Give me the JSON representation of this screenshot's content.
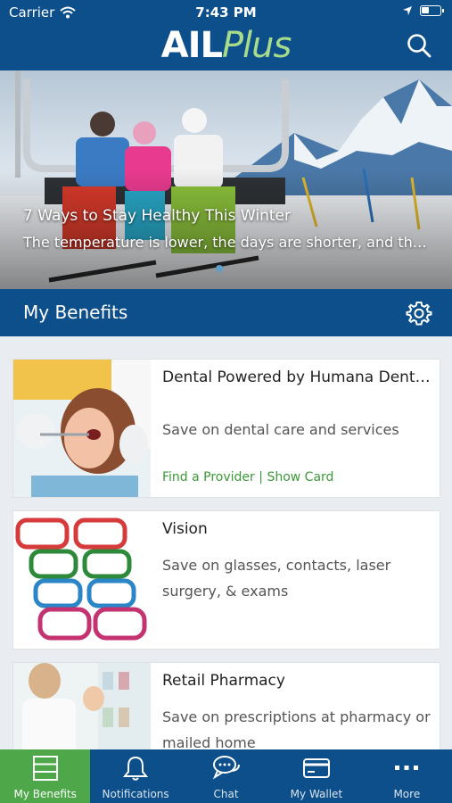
{
  "status_bar": {
    "carrier": "Carrier",
    "time": "7:43 PM"
  },
  "header": {
    "logo_part1": "AIL",
    "logo_part2": "Plus"
  },
  "hero": {
    "title": "7 Ways to Stay Healthy This Winter",
    "description": "The temperature is lower, the days are shorter, and the..."
  },
  "section": {
    "title": "My Benefits"
  },
  "benefits": [
    {
      "title": "Dental Powered by Humana Dental...",
      "description": "Save on dental care and services",
      "link1": "Find a Provider",
      "separator": "|",
      "link2": "Show Card"
    },
    {
      "title": "Vision",
      "description": "Save on glasses, contacts, laser surgery, & exams"
    },
    {
      "title": "Retail Pharmacy",
      "description": "Save on prescriptions at pharmacy or mailed home"
    }
  ],
  "tabs": [
    {
      "label": "My Benefits",
      "icon": "list-icon",
      "active": true
    },
    {
      "label": "Notifications",
      "icon": "bell-icon",
      "active": false
    },
    {
      "label": "Chat",
      "icon": "chat-bubbles-icon",
      "active": false
    },
    {
      "label": "My Wallet",
      "icon": "card-icon",
      "active": false
    },
    {
      "label": "More",
      "icon": "more-dots-icon",
      "active": false
    }
  ],
  "colors": {
    "brand_blue": "#0d4f8b",
    "brand_green": "#4ea84a",
    "link_green": "#3b9a37",
    "logo_green": "#a9dc8a"
  }
}
